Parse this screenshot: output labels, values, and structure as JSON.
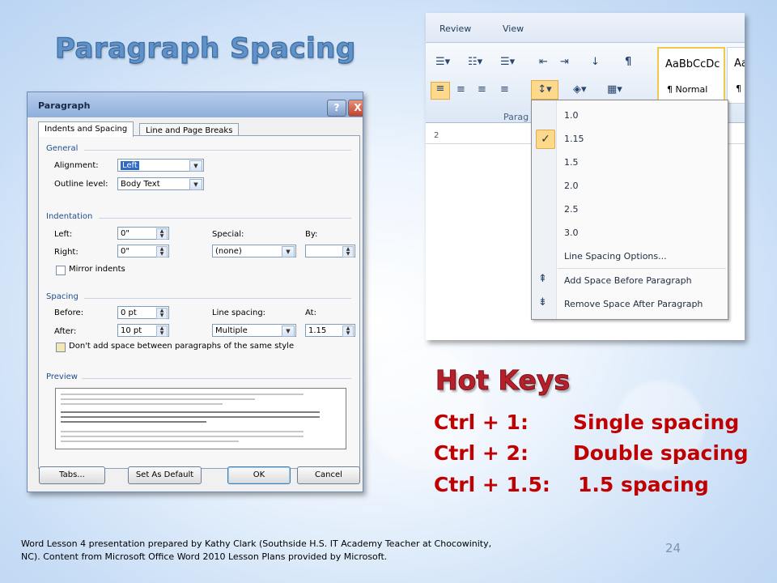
{
  "slide_title": "Paragraph Spacing",
  "dialog": {
    "title": "Paragraph",
    "help_glyph": "?",
    "close_glyph": "X",
    "tabs": [
      "Indents and Spacing",
      "Line and Page Breaks"
    ],
    "general": {
      "heading": "General",
      "alignment_label": "Alignment:",
      "alignment_value": "Left",
      "outline_label": "Outline level:",
      "outline_value": "Body Text"
    },
    "indentation": {
      "heading": "Indentation",
      "left_label": "Left:",
      "left_value": "0\"",
      "right_label": "Right:",
      "right_value": "0\"",
      "special_label": "Special:",
      "special_value": "(none)",
      "by_label": "By:",
      "by_value": "",
      "mirror_label": "Mirror indents"
    },
    "spacing": {
      "heading": "Spacing",
      "before_label": "Before:",
      "before_value": "0 pt",
      "after_label": "After:",
      "after_value": "10 pt",
      "line_label": "Line spacing:",
      "line_value": "Multiple",
      "at_label": "At:",
      "at_value": "1.15",
      "dont_add_label": "Don't add space between paragraphs of the same style"
    },
    "preview_heading": "Preview",
    "buttons": {
      "tabs": "Tabs...",
      "set_default": "Set As Default",
      "ok": "OK",
      "cancel": "Cancel"
    }
  },
  "ribbon": {
    "tabs": [
      "Review",
      "View"
    ],
    "group_label": "Parag",
    "style_normal_sample": "AaBbCcDc",
    "style_normal_name": "¶ Normal",
    "style_next_sample": "Aa",
    "style_next_name": "¶ N",
    "ruler_mark": "2",
    "line_spacing_menu": {
      "items": [
        "1.0",
        "1.15",
        "1.5",
        "2.0",
        "2.5",
        "3.0"
      ],
      "checked_item": "1.15",
      "options_label": "Line Spacing Options...",
      "add_before_label": "Add Space Before Paragraph",
      "remove_after_label": "Remove Space After Paragraph"
    }
  },
  "hot_keys": {
    "title": "Hot Keys",
    "rows": [
      {
        "keys": "Ctrl + 1:",
        "action": "Single spacing"
      },
      {
        "keys": "Ctrl + 2:",
        "action": "Double spacing"
      },
      {
        "keys": "Ctrl + 1.5:",
        "action": "1.5 spacing"
      }
    ]
  },
  "footer_text": "Word Lesson 4 presentation prepared by Kathy Clark (Southside H.S. IT Academy Teacher at Chocowinity, NC). Content from Microsoft Office Word 2010 Lesson Plans provided by Microsoft.",
  "page_number": "24"
}
